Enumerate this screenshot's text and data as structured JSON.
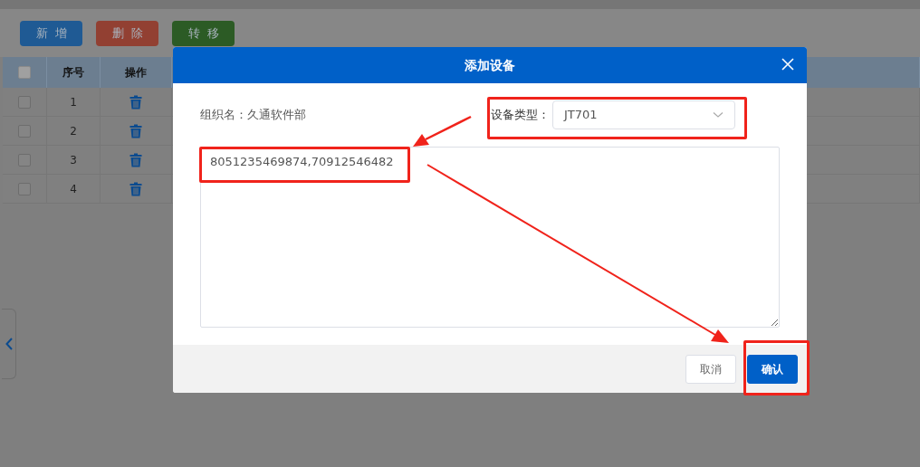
{
  "toolbar": {
    "buttons": [
      {
        "label": "新增",
        "kind": "primary"
      },
      {
        "label": "删除",
        "kind": "danger"
      },
      {
        "label": "转移",
        "kind": "success"
      }
    ]
  },
  "table": {
    "columns": [
      "序号",
      "操作"
    ],
    "header_checked": false,
    "rows": [
      {
        "index": "1",
        "checked": false
      },
      {
        "index": "2",
        "checked": false
      },
      {
        "index": "3",
        "checked": false
      },
      {
        "index": "4",
        "checked": false
      }
    ]
  },
  "dialog": {
    "title": "添加设备",
    "org_label": "组织名：久通软件部",
    "type_label": "设备类型：",
    "type_value": "JT701",
    "device_numbers": "8051235469874,70912546482",
    "buttons": [
      {
        "label": "取消",
        "kind": "secondary"
      },
      {
        "label": "确认",
        "kind": "primary"
      }
    ]
  }
}
